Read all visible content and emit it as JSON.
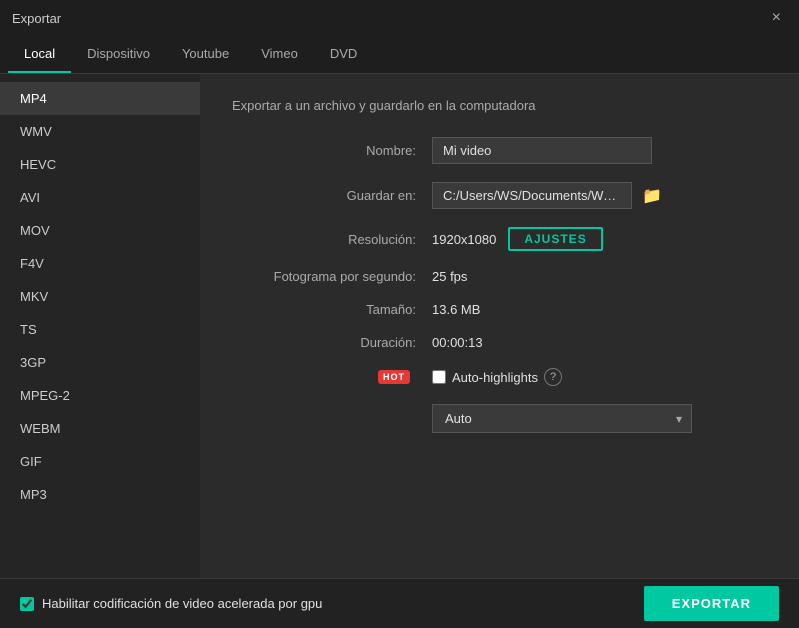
{
  "window": {
    "title": "Exportar",
    "close_label": "×"
  },
  "tabs": [
    {
      "id": "local",
      "label": "Local",
      "active": true
    },
    {
      "id": "dispositivo",
      "label": "Dispositivo",
      "active": false
    },
    {
      "id": "youtube",
      "label": "Youtube",
      "active": false
    },
    {
      "id": "vimeo",
      "label": "Vimeo",
      "active": false
    },
    {
      "id": "dvd",
      "label": "DVD",
      "active": false
    }
  ],
  "sidebar": {
    "items": [
      {
        "id": "mp4",
        "label": "MP4",
        "active": true
      },
      {
        "id": "wmv",
        "label": "WMV",
        "active": false
      },
      {
        "id": "hevc",
        "label": "HEVC",
        "active": false
      },
      {
        "id": "avi",
        "label": "AVI",
        "active": false
      },
      {
        "id": "mov",
        "label": "MOV",
        "active": false
      },
      {
        "id": "f4v",
        "label": "F4V",
        "active": false
      },
      {
        "id": "mkv",
        "label": "MKV",
        "active": false
      },
      {
        "id": "ts",
        "label": "TS",
        "active": false
      },
      {
        "id": "3gp",
        "label": "3GP",
        "active": false
      },
      {
        "id": "mpeg2",
        "label": "MPEG-2",
        "active": false
      },
      {
        "id": "webm",
        "label": "WEBM",
        "active": false
      },
      {
        "id": "gif",
        "label": "GIF",
        "active": false
      },
      {
        "id": "mp3",
        "label": "MP3",
        "active": false
      }
    ]
  },
  "main": {
    "section_title": "Exportar a un archivo y guardarlo en la computadora",
    "fields": {
      "nombre_label": "Nombre:",
      "nombre_value": "Mi video",
      "guardar_label": "Guardar en:",
      "guardar_value": "C:/Users/WS/Documents/Wonders",
      "resolucion_label": "Resolución:",
      "resolucion_value": "1920x1080",
      "ajustes_label": "AJUSTES",
      "fotograma_label": "Fotograma por segundo:",
      "fotograma_value": "25 fps",
      "tamano_label": "Tamaño:",
      "tamano_value": "13.6 MB",
      "duracion_label": "Duración:",
      "duracion_value": "00:00:13",
      "hot_badge": "HOT",
      "auto_highlights_label": "Auto-highlights",
      "help_symbol": "?",
      "dropdown_value": "Auto"
    }
  },
  "bottom": {
    "gpu_label": "Habilitar codificación de video acelerada por gpu",
    "export_label": "EXPORTAR"
  },
  "icons": {
    "folder": "📁",
    "chevron_down": "▾"
  }
}
